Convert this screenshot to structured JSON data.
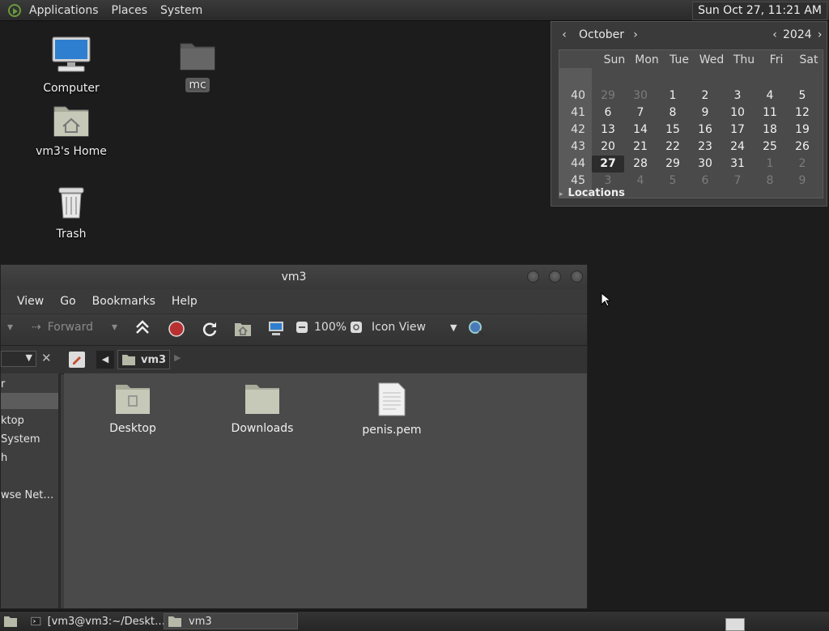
{
  "topbar": {
    "menus": [
      "Applications",
      "Places",
      "System"
    ],
    "clock": "Sun Oct 27, 11:21 AM"
  },
  "desktop": {
    "icons": [
      {
        "label": "Computer"
      },
      {
        "label": "mc"
      },
      {
        "label": "vm3's Home"
      },
      {
        "label": "Trash"
      }
    ]
  },
  "calendar": {
    "month": "October",
    "year": "2024",
    "weekdays": [
      "Sun",
      "Mon",
      "Tue",
      "Wed",
      "Thu",
      "Fri",
      "Sat"
    ],
    "weeks": [
      {
        "num": "40",
        "days": [
          "29",
          "30",
          "1",
          "2",
          "3",
          "4",
          "5"
        ]
      },
      {
        "num": "41",
        "days": [
          "6",
          "7",
          "8",
          "9",
          "10",
          "11",
          "12"
        ]
      },
      {
        "num": "42",
        "days": [
          "13",
          "14",
          "15",
          "16",
          "17",
          "18",
          "19"
        ]
      },
      {
        "num": "43",
        "days": [
          "20",
          "21",
          "22",
          "23",
          "24",
          "25",
          "26"
        ]
      },
      {
        "num": "44",
        "days": [
          "27",
          "28",
          "29",
          "30",
          "31",
          "1",
          "2"
        ]
      },
      {
        "num": "45",
        "days": [
          "3",
          "4",
          "5",
          "6",
          "7",
          "8",
          "9"
        ]
      }
    ],
    "locations_label": "Locations"
  },
  "window": {
    "title": "vm3",
    "menus": [
      "View",
      "Go",
      "Bookmarks",
      "Help"
    ],
    "toolbar": {
      "forward": "Forward",
      "zoom": "100%",
      "view_mode": "Icon View"
    },
    "path": "vm3",
    "sidebar": [
      "r",
      "ktop",
      "System",
      "h",
      "wse Net…"
    ],
    "files": [
      {
        "name": "Desktop"
      },
      {
        "name": "Downloads"
      },
      {
        "name": "penis.pem"
      }
    ]
  },
  "taskbar": {
    "tasks": [
      {
        "label": "[vm3@vm3:~/Deskt…"
      },
      {
        "label": "vm3"
      }
    ]
  }
}
